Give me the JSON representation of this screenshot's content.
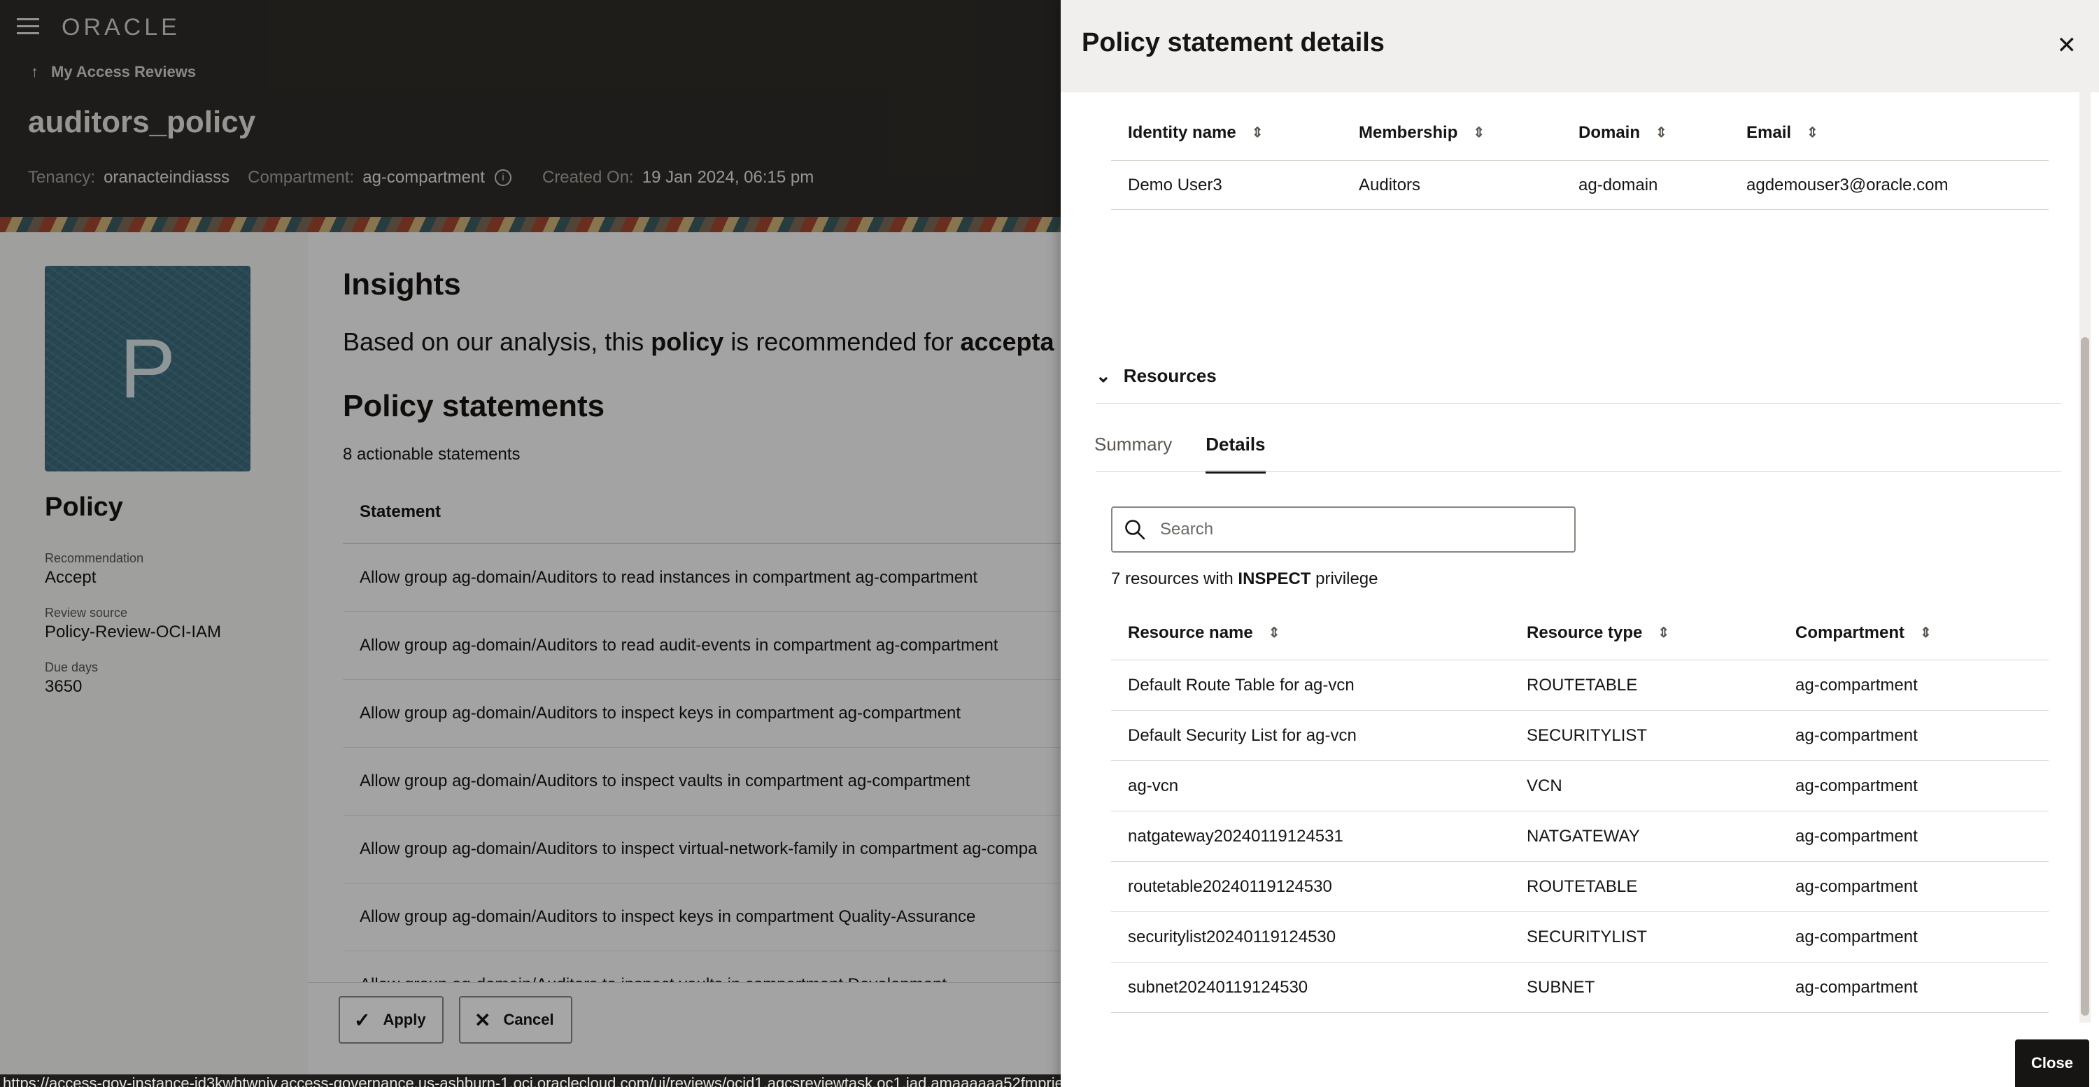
{
  "header": {
    "logo": "ORACLE",
    "back_link": "My Access Reviews",
    "title": "auditors_policy",
    "tenancy_label": "Tenancy:",
    "tenancy_value": "oranacteindiasss",
    "compartment_label": "Compartment:",
    "compartment_value": "ag-compartment",
    "created_label": "Created On:",
    "created_value": "19 Jan 2024, 06:15 pm"
  },
  "sidebar": {
    "avatar_letter": "P",
    "heading": "Policy",
    "recommendation_label": "Recommendation",
    "recommendation_value": "Accept",
    "review_source_label": "Review source",
    "review_source_value": "Policy-Review-OCI-IAM",
    "due_days_label": "Due days",
    "due_days_value": "3650"
  },
  "main": {
    "insights_title": "Insights",
    "insights_pre": "Based on our analysis, this",
    "insights_bold1": "policy",
    "insights_mid": "is recommended for",
    "insights_bold2": "accepta",
    "statements_title": "Policy statements",
    "statements_count": "8 actionable statements",
    "statement_header": "Statement",
    "statements": [
      "Allow group ag-domain/Auditors to read instances in compartment ag-compartment",
      "Allow group ag-domain/Auditors to read audit-events in compartment ag-compartment",
      "Allow group ag-domain/Auditors to inspect keys in compartment ag-compartment",
      "Allow group ag-domain/Auditors to inspect vaults in compartment ag-compartment",
      "Allow group ag-domain/Auditors to inspect virtual-network-family in compartment ag-compa",
      "Allow group ag-domain/Auditors to inspect keys in compartment Quality-Assurance",
      "Allow group ag-domain/Auditors to inspect vaults in compartment Development"
    ],
    "apply_label": "Apply",
    "cancel_label": "Cancel"
  },
  "status_url": "https://access-gov-instance-id3kwhtwniv.access-governance.us-ashburn-1.oci.oraclecloud.com/ui/reviews/ocid1.agcsreviewtask.oc1.iad.amaaaaaa52fmpriete6d5rq6fum2miae7phdktlei3ay26a2dvwoygv7riz#",
  "drawer": {
    "title": "Policy statement details",
    "identity_columns": [
      "Identity name",
      "Membership",
      "Domain",
      "Email"
    ],
    "identities": [
      [
        "Demo User3",
        "Auditors",
        "ag-domain",
        "agdemouser3@oracle.com"
      ]
    ],
    "resources_section": "Resources",
    "tabs": [
      "Summary",
      "Details"
    ],
    "active_tab": "Details",
    "search_placeholder": "Search",
    "resource_count_pre": "7 resources with",
    "resource_count_bold": "INSPECT",
    "resource_count_post": "privilege",
    "resource_columns": [
      "Resource name",
      "Resource type",
      "Compartment"
    ],
    "resources": [
      [
        "Default Route Table for ag-vcn",
        "ROUTETABLE",
        "ag-compartment"
      ],
      [
        "Default Security List for ag-vcn",
        "SECURITYLIST",
        "ag-compartment"
      ],
      [
        "ag-vcn",
        "VCN",
        "ag-compartment"
      ],
      [
        "natgateway20240119124531",
        "NATGATEWAY",
        "ag-compartment"
      ],
      [
        "routetable20240119124530",
        "ROUTETABLE",
        "ag-compartment"
      ],
      [
        "securitylist20240119124530",
        "SECURITYLIST",
        "ag-compartment"
      ],
      [
        "subnet20240119124530",
        "SUBNET",
        "ag-compartment"
      ]
    ],
    "close_label": "Close"
  }
}
